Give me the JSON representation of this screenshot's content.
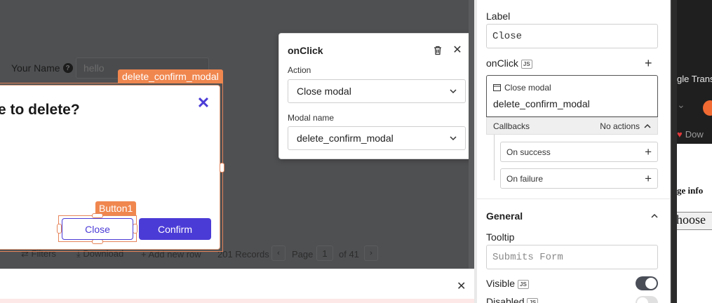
{
  "canvas": {
    "name_label": "Your Name",
    "name_value": "hello",
    "toolbar": {
      "filters": "Filters",
      "download": "Download",
      "add_row": "Add new row",
      "records": "201 Records",
      "page_label": "Page",
      "page_num": "1",
      "of_pages": "of 41"
    }
  },
  "modal": {
    "tag": "delete_confirm_modal",
    "title": "e to delete?",
    "close_icon": "close-icon",
    "button_tag": "Button1",
    "close_label": "Close",
    "confirm_label": "Confirm",
    "accent": "#4b3bd6",
    "selection_color": "#f0874f"
  },
  "popover": {
    "title": "onClick",
    "action_label": "Action",
    "action_value": "Close modal",
    "modal_name_label": "Modal name",
    "modal_name_value": "delete_confirm_modal"
  },
  "pane": {
    "label_label": "Label",
    "label_value": "Close",
    "onclick_label": "onClick",
    "js_badge": "JS",
    "action_type": "Close modal",
    "action_value": "delete_confirm_modal",
    "callbacks_label": "Callbacks",
    "callbacks_status": "No actions",
    "on_success": "On success",
    "on_failure": "On failure",
    "general": "General",
    "tooltip_label": "Tooltip",
    "tooltip_placeholder": "Submits Form",
    "visible_label": "Visible",
    "visible_on": true,
    "disabled_label": "Disabled",
    "disabled_on": false
  },
  "background_window": {
    "tab_text": "gle Transl",
    "download_text": "Dow",
    "page_text": "ge info",
    "button_text": "hoose"
  }
}
